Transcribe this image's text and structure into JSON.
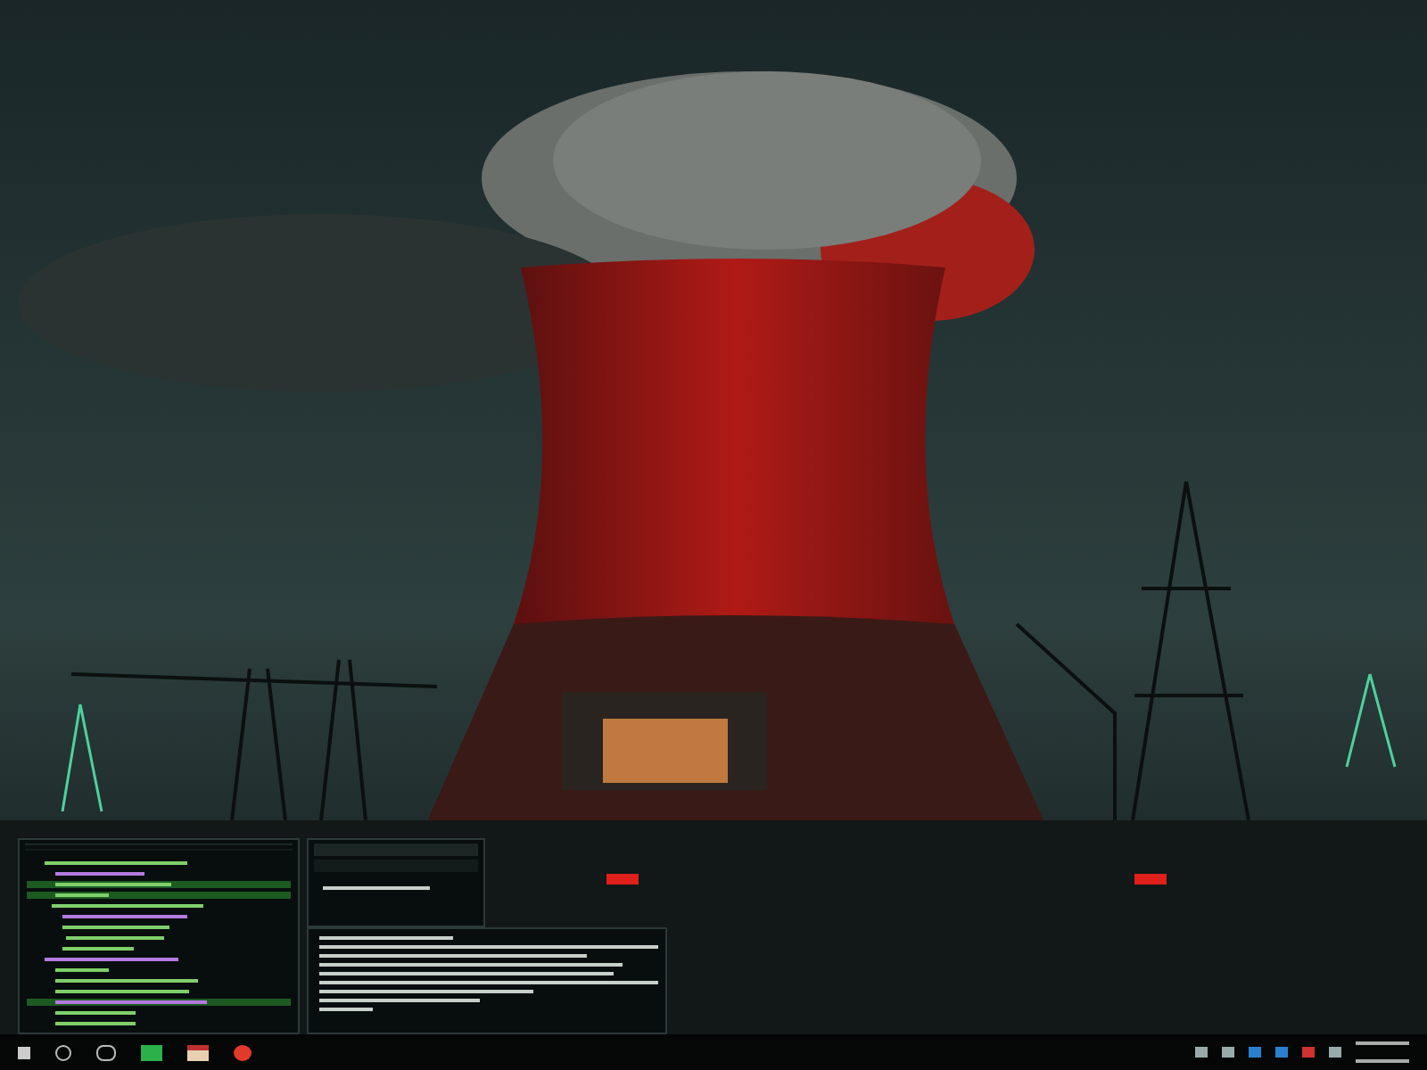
{
  "windows": [
    {
      "kind": "tree",
      "rows": [
        {
          "selected": false
        },
        {
          "selected": false
        },
        {
          "selected": true
        },
        {
          "selected": true
        },
        {
          "selected": false
        },
        {
          "selected": false
        },
        {
          "selected": false
        },
        {
          "selected": false
        },
        {
          "selected": false
        },
        {
          "selected": false
        },
        {
          "selected": false
        },
        {
          "selected": false
        },
        {
          "selected": false
        },
        {
          "selected": true
        },
        {
          "selected": false
        },
        {
          "selected": false
        }
      ]
    },
    {
      "kind": "panel"
    },
    {
      "kind": "console"
    }
  ]
}
